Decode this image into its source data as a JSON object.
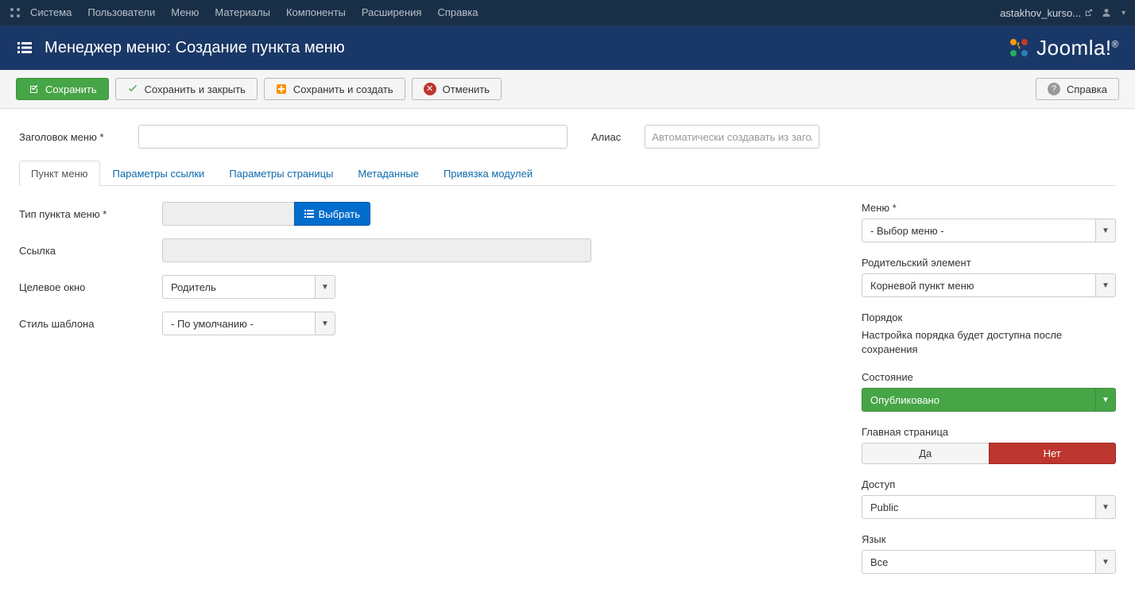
{
  "topnav": {
    "items": [
      "Система",
      "Пользователи",
      "Меню",
      "Материалы",
      "Компоненты",
      "Расширения",
      "Справка"
    ],
    "user": "astakhov_kurso..."
  },
  "header": {
    "title": "Менеджер меню: Создание пункта меню",
    "logo_text": "Joomla!"
  },
  "toolbar": {
    "save": "Сохранить",
    "save_close": "Сохранить и закрыть",
    "save_new": "Сохранить и создать",
    "cancel": "Отменить",
    "help": "Справка"
  },
  "fields": {
    "title_label": "Заголовок меню *",
    "alias_label": "Алиас",
    "alias_placeholder": "Автоматически создавать из загол"
  },
  "tabs": [
    "Пункт меню",
    "Параметры ссылки",
    "Параметры страницы",
    "Метаданные",
    "Привязка модулей"
  ],
  "left": {
    "type_label": "Тип пункта меню *",
    "type_button": "Выбрать",
    "link_label": "Ссылка",
    "target_label": "Целевое окно",
    "target_value": "Родитель",
    "template_label": "Стиль шаблона",
    "template_value": "- По умолчанию -"
  },
  "right": {
    "menu_label": "Меню *",
    "menu_value": "- Выбор меню -",
    "parent_label": "Родительский элемент",
    "parent_value": "Корневой пункт меню",
    "order_label": "Порядок",
    "order_text": "Настройка порядка будет доступна после сохранения",
    "state_label": "Состояние",
    "state_value": "Опубликовано",
    "home_label": "Главная страница",
    "home_yes": "Да",
    "home_no": "Нет",
    "access_label": "Доступ",
    "access_value": "Public",
    "lang_label": "Язык",
    "lang_value": "Все"
  }
}
